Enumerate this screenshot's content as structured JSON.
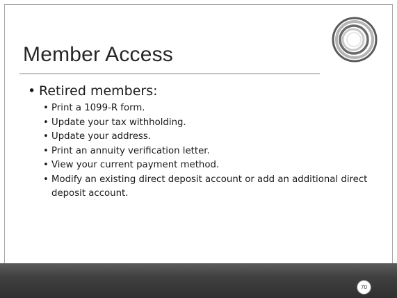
{
  "slide": {
    "title": "Member Access",
    "bullet_symbol": "•",
    "main_point": "Retired members:",
    "sub_points": [
      "Print a 1099-R form.",
      "Update your tax withholding.",
      "Update your address.",
      "Print an annuity verification letter.",
      "View your current payment method.",
      "Modify an existing direct deposit account or add an additional direct deposit account."
    ],
    "page_number": "70"
  },
  "colors": {
    "title": "#262626",
    "footer": "#404040",
    "logo_dark": "#555555",
    "logo_light": "#bdbdbd"
  },
  "icons": {
    "logo": "concentric-rings-logo"
  }
}
